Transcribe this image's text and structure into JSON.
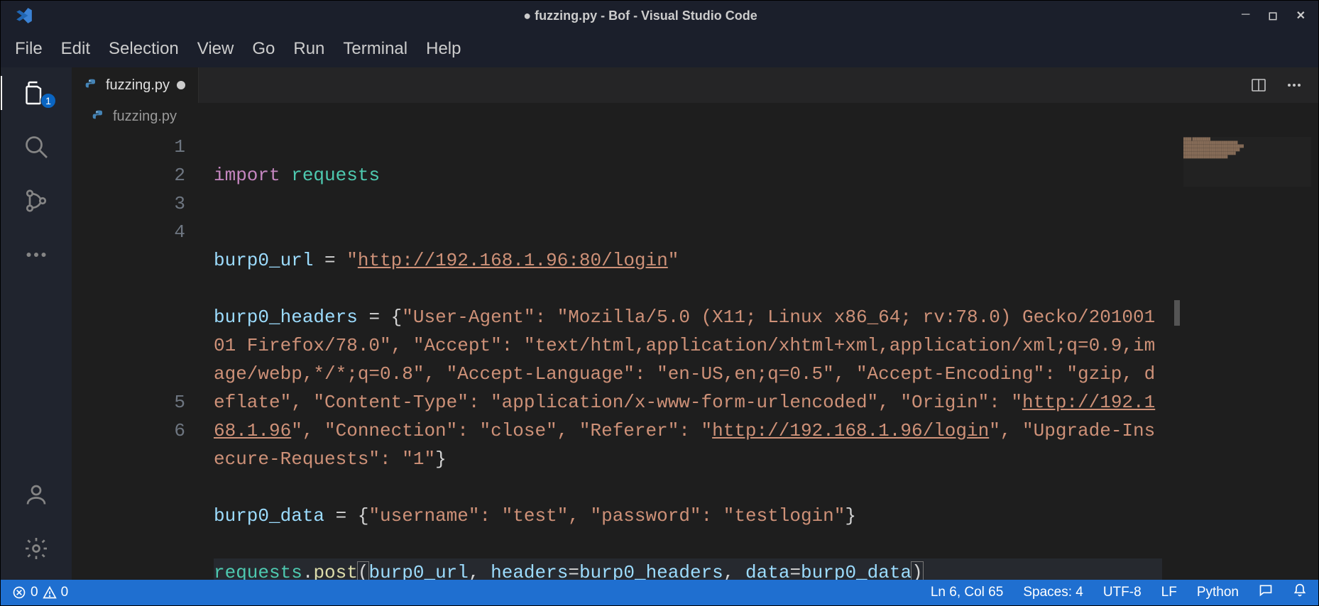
{
  "window": {
    "title": "● fuzzing.py - Bof - Visual Studio Code"
  },
  "menu": {
    "items": [
      "File",
      "Edit",
      "Selection",
      "View",
      "Go",
      "Run",
      "Terminal",
      "Help"
    ]
  },
  "activity": {
    "explorer_badge": "1"
  },
  "tab": {
    "icon": "python-icon",
    "label": "fuzzing.py"
  },
  "breadcrumb": {
    "file": "fuzzing.py"
  },
  "gutter_lines": [
    "1",
    "2",
    "3",
    "4",
    "5",
    "6"
  ],
  "code_raw": "import requests\n\nburp0_url = \"http://192.168.1.96:80/login\"\nburp0_headers = {\"User-Agent\": \"Mozilla/5.0 (X11; Linux x86_64; rv:78.0) Gecko/20100101 Firefox/78.0\", \"Accept\": \"text/html,application/xhtml+xml,application/xml;q=0.9,image/webp,*/*;q=0.8\", \"Accept-Language\": \"en-US,en;q=0.5\", \"Accept-Encoding\": \"gzip, deflate\", \"Content-Type\": \"application/x-www-form-urlencoded\", \"Origin\": \"http://192.168.1.96\", \"Connection\": \"close\", \"Referer\": \"http://192.168.1.96/login\", \"Upgrade-Insecure-Requests\": \"1\"}\nburp0_data = {\"username\": \"test\", \"password\": \"testlogin\"}\nrequests.post(burp0_url, headers=burp0_headers, data=burp0_data)",
  "code": {
    "l1_import": "import",
    "l1_requests": " requests",
    "l2": "",
    "l3_var": "burp0_url",
    "l3_eq": " = ",
    "l3_q1": "\"",
    "l3_url": "http://192.168.1.96:80/login",
    "l3_q2": "\"",
    "l4_var": "burp0_headers",
    "l4_eq": " = {",
    "l4_str": "\"User-Agent\": \"Mozilla/5.0 (X11; Linux x86_64; rv:78.0) Gecko/20100101 Firefox/78.0\", \"Accept\": \"text/html,application/xhtml+xml,application/xml;q=0.9,image/webp,*/*;q=0.8\", \"Accept-Language\": \"en-US,en;q=0.5\", \"Accept-Encoding\": \"gzip, deflate\", \"Content-Type\": \"application/x-www-form-urlencoded\", \"Origin\": \"",
    "l4_origin": "http://192.168.1.96",
    "l4_mid": "\", \"Connection\": \"close\", \"Referer\": \"",
    "l4_referer": "http://192.168.1.96/login",
    "l4_end": "\", \"Upgrade-Insecure-Requests\": \"1\"",
    "l4_close": "}",
    "l5_var": "burp0_data",
    "l5_eq": " = {",
    "l5_str": "\"username\": \"test\", \"password\": \"testlogin\"",
    "l5_close": "}",
    "l6_obj": "requests",
    "l6_dot": ".",
    "l6_func": "post",
    "l6_open": "(",
    "l6_arg1": "burp0_url",
    "l6_c1": ", ",
    "l6_kw1": "headers",
    "l6_e1": "=",
    "l6_v1": "burp0_headers",
    "l6_c2": ", ",
    "l6_kw2": "data",
    "l6_e2": "=",
    "l6_v2": "burp0_data",
    "l6_close": ")"
  },
  "status": {
    "errors": "0",
    "warnings": "0",
    "cursor": "Ln 6, Col 65",
    "indent": "Spaces: 4",
    "encoding": "UTF-8",
    "eol": "LF",
    "language": "Python"
  }
}
